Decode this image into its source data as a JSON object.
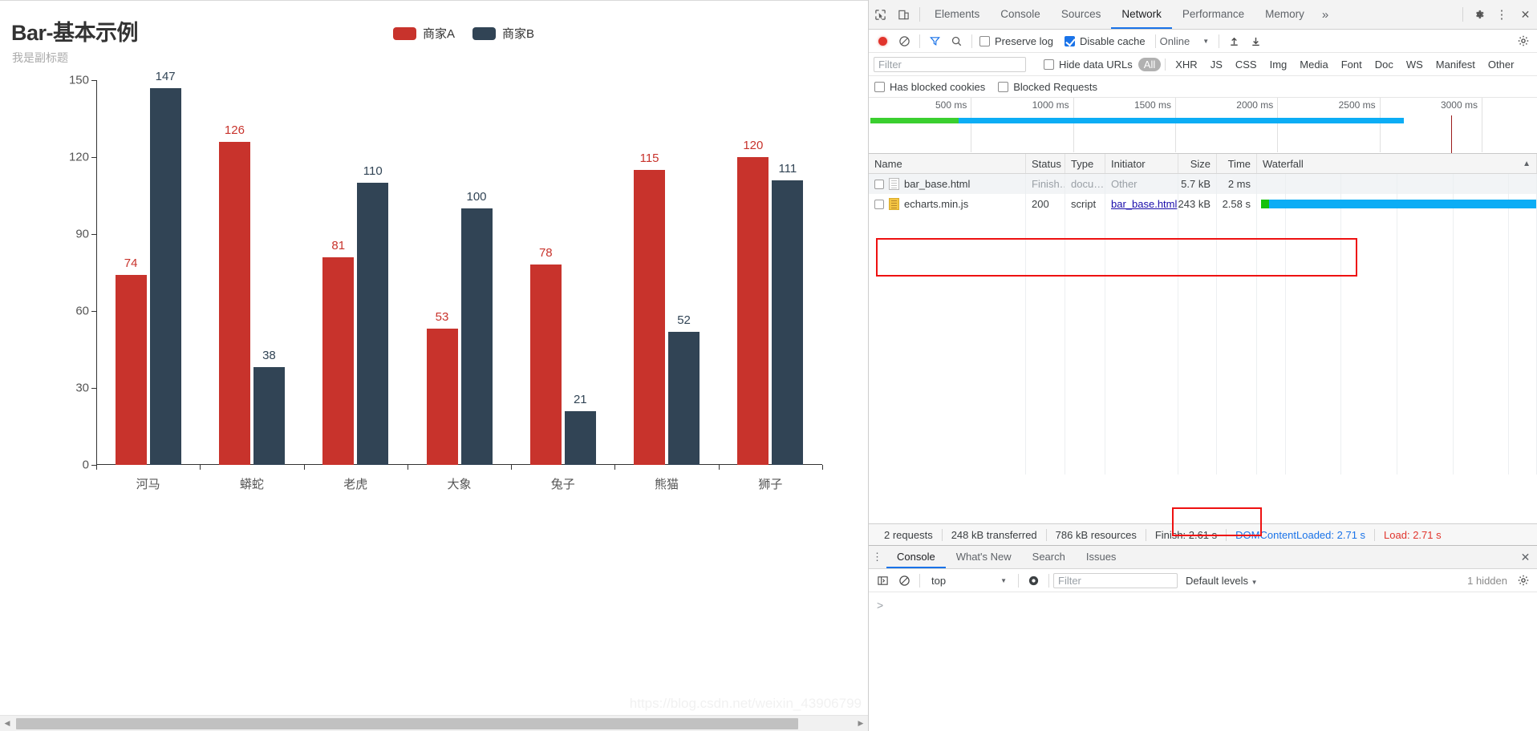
{
  "chart_data": {
    "type": "bar",
    "title": "Bar-基本示例",
    "subtitle": "我是副标题",
    "xlabel": "",
    "ylabel": "",
    "grid": false,
    "legend_position": "top-center",
    "ylim": [
      0,
      150
    ],
    "yticks": [
      0,
      30,
      60,
      90,
      120,
      150
    ],
    "categories": [
      "河马",
      "蟒蛇",
      "老虎",
      "大象",
      "兔子",
      "熊猫",
      "狮子"
    ],
    "series": [
      {
        "name": "商家A",
        "color": "#c8332c",
        "label_color": "#c8332c",
        "values": [
          74,
          126,
          81,
          53,
          78,
          115,
          120
        ]
      },
      {
        "name": "商家B",
        "color": "#314455",
        "label_color": "#314455",
        "values": [
          147,
          38,
          110,
          100,
          21,
          52,
          111
        ]
      }
    ]
  },
  "page": {
    "watermark": "https://blog.csdn.net/weixin_43906799",
    "scrollbar": {
      "left_arrow": "◀",
      "right_arrow": "▶"
    }
  },
  "devtools": {
    "icons": {
      "inspect": "inspect-element-icon",
      "device": "device-toolbar-icon",
      "more": "»",
      "settings": "gear-icon",
      "kebab": "⋮",
      "close": "✕"
    },
    "tabs": [
      {
        "label": "Elements",
        "active": false
      },
      {
        "label": "Console",
        "active": false
      },
      {
        "label": "Sources",
        "active": false
      },
      {
        "label": "Network",
        "active": true
      },
      {
        "label": "Performance",
        "active": false
      },
      {
        "label": "Memory",
        "active": false
      }
    ],
    "network_toolbar": {
      "record_tooltip": "record-button",
      "clear_tooltip": "clear-button",
      "filter_tooltip": "filter-button",
      "search_tooltip": "search-button",
      "preserve_log_label": "Preserve log",
      "preserve_log_checked": false,
      "disable_cache_label": "Disable cache",
      "disable_cache_checked": true,
      "throttling_value": "Online",
      "import_tooltip": "import-har-button",
      "export_tooltip": "export-har-button"
    },
    "filter_bar": {
      "filter_placeholder": "Filter",
      "filter_value": "",
      "hide_data_urls_label": "Hide data URLs",
      "hide_data_urls_checked": false,
      "types": [
        "All",
        "XHR",
        "JS",
        "CSS",
        "Img",
        "Media",
        "Font",
        "Doc",
        "WS",
        "Manifest",
        "Other"
      ],
      "active_type": "All"
    },
    "blocked_bar": {
      "has_blocked_cookies_label": "Has blocked cookies",
      "has_blocked_cookies_checked": false,
      "blocked_requests_label": "Blocked Requests",
      "blocked_requests_checked": false
    },
    "overview": {
      "ticks": [
        "500 ms",
        "1000 ms",
        "1500 ms",
        "2000 ms",
        "2500 ms",
        "3000 ms"
      ]
    },
    "table": {
      "columns": [
        "Name",
        "Status",
        "Type",
        "Initiator",
        "Size",
        "Time",
        "Waterfall"
      ],
      "sort_indicator": "▲",
      "rows": [
        {
          "name": "bar_base.html",
          "status": "Finish…",
          "type": "docu…",
          "initiator": "Other",
          "initiator_is_link": false,
          "size": "5.7 kB",
          "time": "2 ms",
          "icon": "document-icon"
        },
        {
          "name": "echarts.min.js",
          "status": "200",
          "type": "script",
          "initiator": "bar_base.html",
          "initiator_is_link": true,
          "size": "243 kB",
          "time": "2.58 s",
          "icon": "script-icon"
        }
      ]
    },
    "status_bar": {
      "requests": "2 requests",
      "transferred": "248 kB transferred",
      "resources": "786 kB resources",
      "finish": "Finish: 2.61 s",
      "dom_content_loaded": "DOMContentLoaded: 2.71 s",
      "load": "Load: 2.71 s"
    },
    "drawer": {
      "tabs": [
        {
          "label": "Console",
          "active": true
        },
        {
          "label": "What's New",
          "active": false
        },
        {
          "label": "Search",
          "active": false
        },
        {
          "label": "Issues",
          "active": false
        }
      ],
      "toolbar": {
        "sidebar_tooltip": "console-sidebar-button",
        "clear_tooltip": "clear-console-button",
        "context": "top",
        "eye_tooltip": "live-expression-button",
        "filter_placeholder": "Filter",
        "filter_value": "",
        "levels": "Default levels",
        "hidden_count": "1 hidden"
      },
      "prompt": ">"
    },
    "colors": {
      "accent": "#1a73e8",
      "record_red": "#e1342c",
      "load_red": "#e1342c",
      "annotation_red": "#ee1111",
      "waterfall_blue": "#0cadf5",
      "waterfall_green": "#15c10a"
    }
  }
}
